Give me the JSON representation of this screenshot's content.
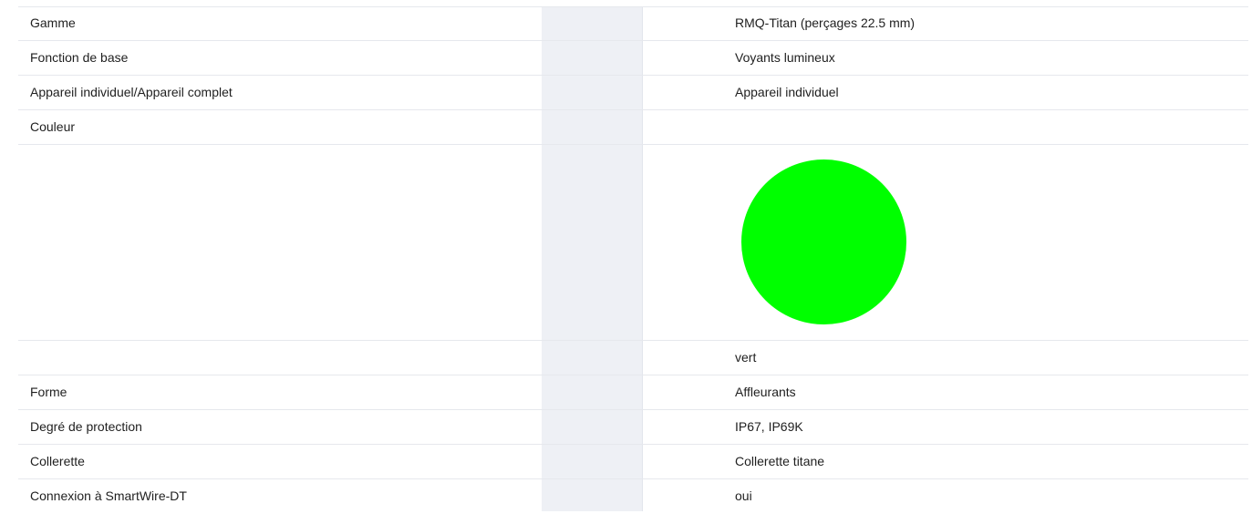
{
  "rows": [
    {
      "label": "Gamme",
      "value": "RMQ-Titan (perçages 22.5 mm)"
    },
    {
      "label": "Fonction de base",
      "value": "Voyants lumineux"
    },
    {
      "label": "Appareil individuel/Appareil complet",
      "value": "Appareil individuel"
    },
    {
      "label": "Couleur",
      "value": ""
    },
    {
      "label": "",
      "value": ""
    },
    {
      "label": "",
      "value": "vert"
    },
    {
      "label": "Forme",
      "value": "Affleurants"
    },
    {
      "label": "Degré de protection",
      "value": "IP67, IP69K"
    },
    {
      "label": "Collerette",
      "value": "Collerette titane"
    },
    {
      "label": "Connexion à SmartWire-DT",
      "value": "oui"
    }
  ],
  "color_swatch": {
    "color": "#00ff00",
    "shape": "circle"
  }
}
